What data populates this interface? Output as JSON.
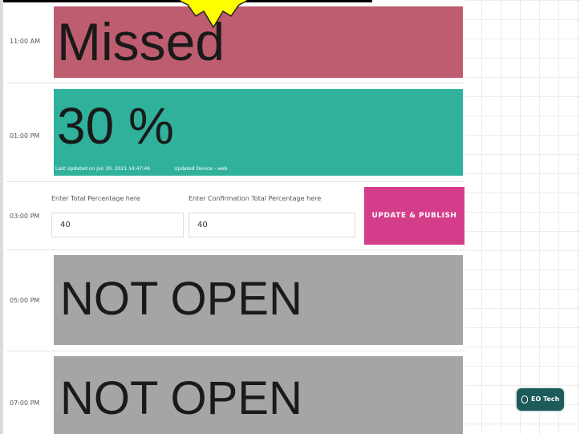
{
  "schedule": {
    "slots": [
      {
        "time": "11:00 AM",
        "status": "Missed",
        "color": "#bd5d6f"
      },
      {
        "time": "01:00 PM",
        "status": "30 %",
        "last_updated": "Last Updated on Jun 30, 2021 14:47:46",
        "updated_device": "Updated Device - web",
        "color": "#2fb19c"
      },
      {
        "time": "03:00 PM"
      },
      {
        "time": "05:00 PM",
        "status": "NOT OPEN",
        "color": "#a6a4a5"
      },
      {
        "time": "07:00 PM",
        "status": "NOT OPEN",
        "color": "#a6a4a5"
      }
    ]
  },
  "form": {
    "total_label": "Enter Total Percentage here",
    "total_value": "40",
    "confirm_label": "Enter Confirmation Total Percentage here",
    "confirm_value": "40",
    "publish_label": "UPDATE & PUBLISH",
    "publish_color": "#d43d8a"
  },
  "floating_button": {
    "label": "EO Tech",
    "icon": "mouse-icon",
    "color": "#1d5a5a"
  },
  "decoration": {
    "star_color": "#ffff00"
  }
}
